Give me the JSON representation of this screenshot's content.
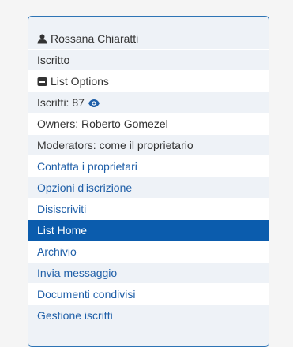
{
  "user": {
    "icon": "user-icon",
    "name": "Rossana Chiaratti",
    "status": "Iscritto"
  },
  "list_options": {
    "icon": "list-options-icon",
    "label": "List Options"
  },
  "subscribers": {
    "label": "Iscritti: 87",
    "icon": "eye-icon"
  },
  "owners": "Owners: Roberto Gomezel",
  "moderators": "Moderators: come il proprietario",
  "links": {
    "contact_owners": "Contatta i proprietari",
    "subscription_options": "Opzioni d'iscrizione",
    "unsubscribe": "Disiscriviti",
    "list_home": "List Home",
    "archive": "Archivio",
    "send_message": "Invia messaggio",
    "shared_documents": "Documenti condivisi",
    "manage_subscribers": "Gestione iscritti"
  },
  "colors": {
    "accent": "#0b5cad",
    "link": "#1f5fa8",
    "panel_border": "#2e74b5",
    "panel_bg": "#eef2f7"
  }
}
